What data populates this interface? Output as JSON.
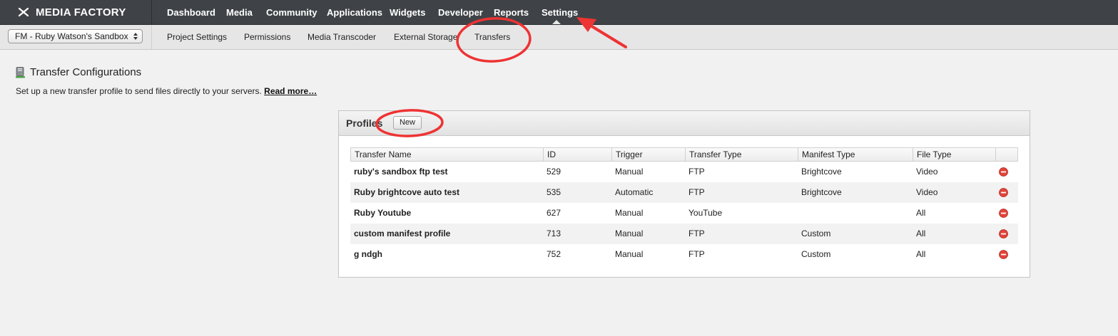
{
  "app": {
    "logo_text": "MEDIA FACTORY"
  },
  "main_nav": {
    "items": [
      {
        "label": "Dashboard"
      },
      {
        "label": "Media"
      },
      {
        "label": "Community"
      },
      {
        "label": "Applications"
      },
      {
        "label": "Widgets"
      },
      {
        "label": "Developer"
      },
      {
        "label": "Reports"
      },
      {
        "label": "Settings"
      }
    ],
    "active": "Settings"
  },
  "project_selector": {
    "value": "FM - Ruby Watson's Sandbox"
  },
  "sub_nav": {
    "items": [
      {
        "label": "Project Settings"
      },
      {
        "label": "Permissions"
      },
      {
        "label": "Media Transcoder"
      },
      {
        "label": "External Storage"
      },
      {
        "label": "Transfers"
      }
    ],
    "active": "Transfers"
  },
  "page": {
    "title": "Transfer Configurations",
    "description": "Set up a new transfer profile to send files directly to your servers.",
    "read_more": "Read more…"
  },
  "profiles": {
    "title": "Profiles",
    "new_button": "New",
    "columns": [
      "Transfer Name",
      "ID",
      "Trigger",
      "Transfer Type",
      "Manifest Type",
      "File Type",
      ""
    ],
    "rows": [
      {
        "name": "ruby's sandbox ftp test",
        "id": "529",
        "trigger": "Manual",
        "transfer_type": "FTP",
        "manifest_type": "Brightcove",
        "file_type": "Video"
      },
      {
        "name": "Ruby brightcove auto test",
        "id": "535",
        "trigger": "Automatic",
        "transfer_type": "FTP",
        "manifest_type": "Brightcove",
        "file_type": "Video"
      },
      {
        "name": "Ruby Youtube",
        "id": "627",
        "trigger": "Manual",
        "transfer_type": "YouTube",
        "manifest_type": "",
        "file_type": "All"
      },
      {
        "name": "custom manifest profile",
        "id": "713",
        "trigger": "Manual",
        "transfer_type": "FTP",
        "manifest_type": "Custom",
        "file_type": "All"
      },
      {
        "name": "g ndgh",
        "id": "752",
        "trigger": "Manual",
        "transfer_type": "FTP",
        "manifest_type": "Custom",
        "file_type": "All"
      }
    ]
  },
  "colors": {
    "topbar": "#3f4347",
    "annotation_red": "#ee3333",
    "delete_red": "#e0443a"
  },
  "icons": [
    "logo-icon",
    "select-arrows-icon",
    "server-icon",
    "delete-icon"
  ]
}
